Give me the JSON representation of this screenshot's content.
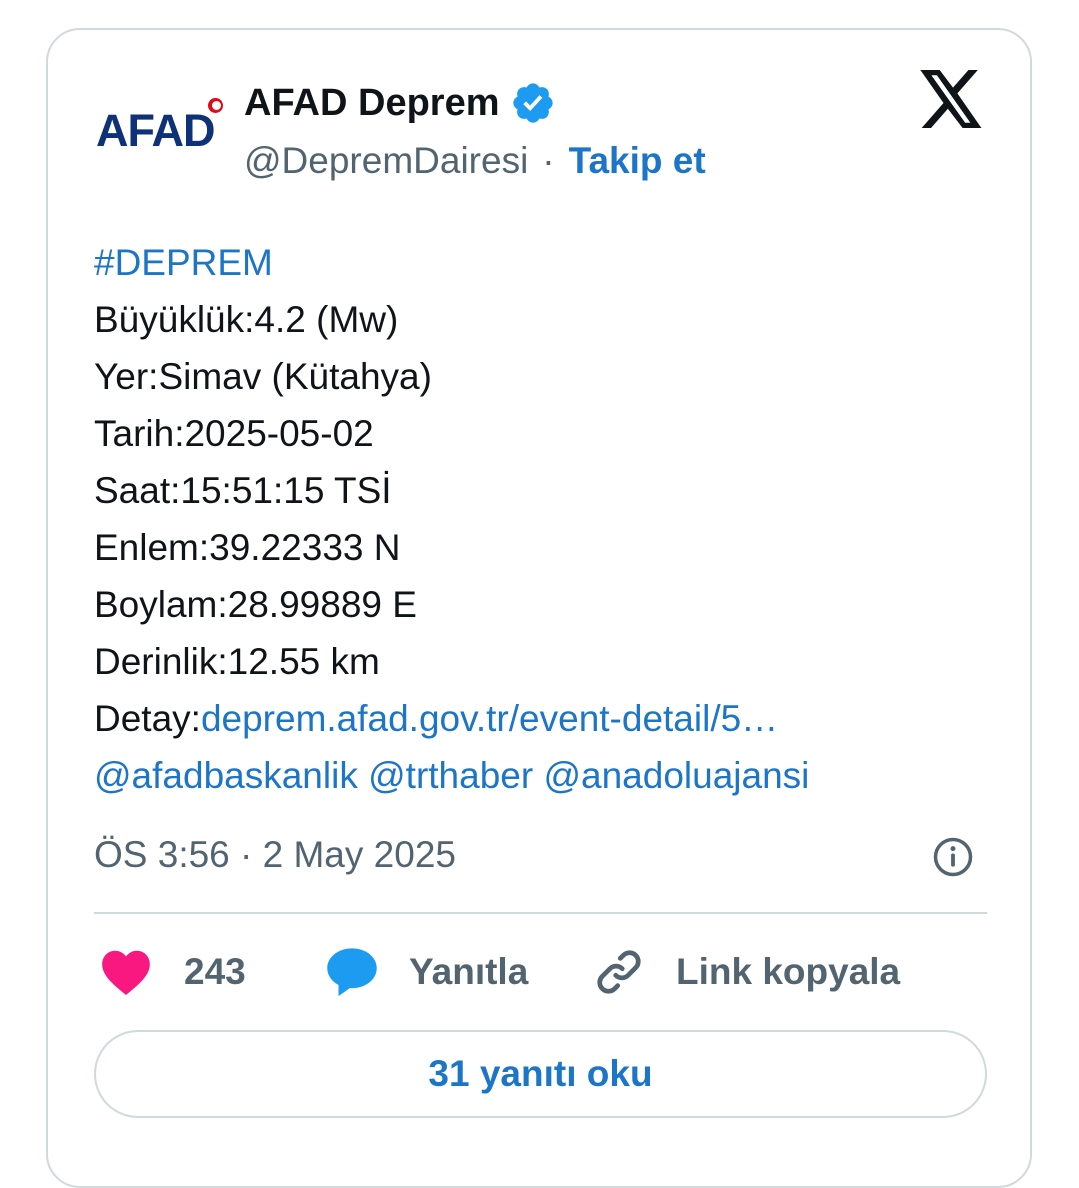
{
  "account": {
    "logo_text": "AFAD",
    "name": "AFAD Deprem",
    "handle": "@DepremDairesi",
    "separator": "·",
    "follow_label": "Takip et"
  },
  "tweet": {
    "hashtag": "#DEPREM",
    "lines": {
      "magnitude": "Büyüklük:4.2 (Mw)",
      "location": "Yer:Simav (Kütahya)",
      "date": "Tarih:2025-05-02",
      "time": "Saat:15:51:15 TSİ",
      "latitude": "Enlem:39.22333 N",
      "longitude": "Boylam:28.99889 E",
      "depth": "Derinlik:12.55 km"
    },
    "detail_prefix": "Detay:",
    "detail_link": "deprem.afad.gov.tr/event-detail/5…",
    "mentions": [
      "@afadbaskanlik",
      "@trthaber",
      "@anadoluajansi"
    ]
  },
  "meta": {
    "timestamp": "ÖS 3:56 · 2 May 2025"
  },
  "actions": {
    "like_count": "243",
    "reply_label": "Yanıtla",
    "copy_link_label": "Link kopyala"
  },
  "read_replies_label": "31 yanıtı oku",
  "colors": {
    "accent": "#1d75c8",
    "like": "#f91880",
    "reply_icon": "#1d9bf0",
    "verified": "#1d9bf0",
    "text": "#0f1419",
    "muted": "#536471",
    "border": "#cfd9de"
  },
  "icons": {
    "verified": "verified-badge-icon",
    "x_logo": "x-logo-icon",
    "info": "info-icon",
    "like": "heart-icon",
    "reply": "speech-bubble-icon",
    "copy_link": "link-icon"
  }
}
